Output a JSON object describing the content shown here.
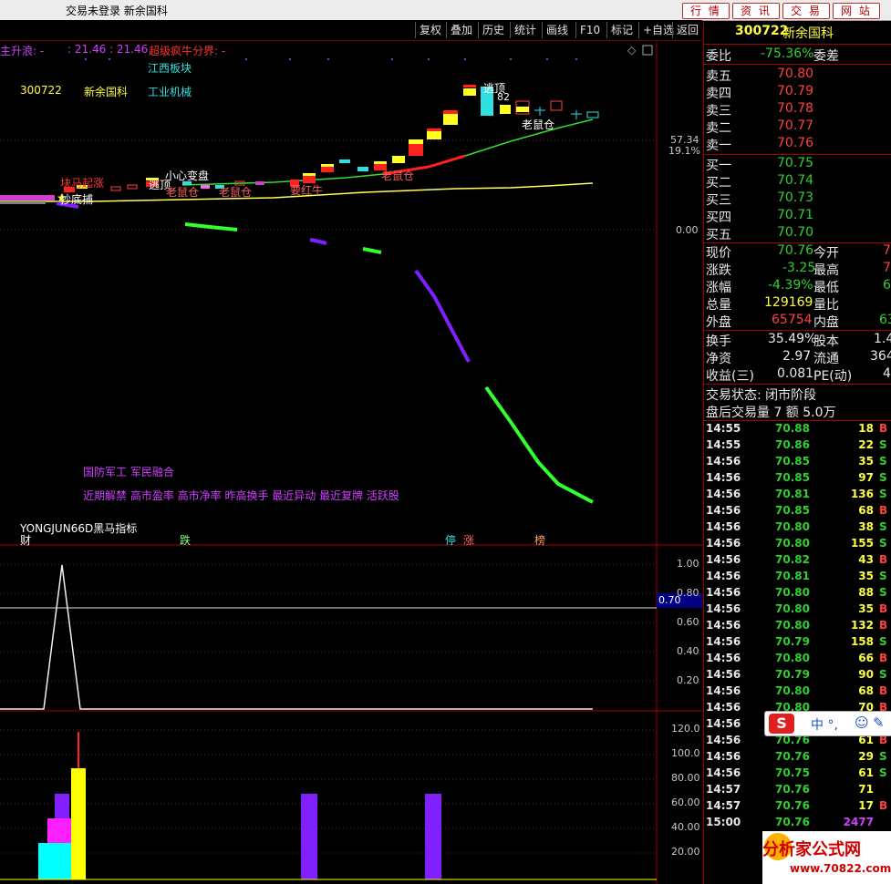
{
  "window": {
    "title": "交易未登录  新余国科",
    "nav_buttons": [
      "行 情",
      "资 讯",
      "交 易",
      "网 站"
    ]
  },
  "toolbar": [
    "复权",
    "叠加",
    "历史",
    "统计",
    "画线",
    "F10",
    "标记",
    "+自选",
    "返回"
  ],
  "chart": {
    "legend_prefix": "主升浪: -",
    "legend_values": ": 21.46 : 21.46",
    "legend_label": "超级疯牛分界: -",
    "sector": "江西板块",
    "code": "300722",
    "name": "新余国科",
    "industry": "工业机械",
    "concepts1": "国防军工 军民融合",
    "concepts2": "近期解禁 高市盈率 高市净率 昨高换手 最近异动 最近复牌 活跃股",
    "indicator": "YONGJUN66D黑马指标",
    "price_labels": [
      "57.34",
      "19.1%",
      "0.00"
    ],
    "annotations": {
      "taopao": "逃顶",
      "taopao2": "逃顶",
      "xiaoxin": "小心变盘",
      "laoshu1": "老鼠仓",
      "laoshu2": "老鼠仓",
      "laoshu3": "老鼠仓",
      "laoshu4": "老鼠仓",
      "liqizhang": "块马起涨",
      "chaodi": "抄底捕",
      "hongbao": "要红牛",
      "val": "82"
    },
    "bottom_marks": [
      "财",
      "跌",
      "停",
      "涨",
      "榜"
    ],
    "sub1_labels": [
      "1.00",
      "0.80",
      "0.60",
      "0.40",
      "0.20"
    ],
    "sub1_current": "0.70",
    "sub2_labels": [
      "120.0",
      "100.0",
      "80.00",
      "60.00",
      "40.00",
      "20.00"
    ]
  },
  "quote": {
    "code": "300722",
    "name": "新余国科",
    "weibi_label": "委比",
    "weibi": "-75.36%",
    "weicha_label": "委差",
    "sell": [
      {
        "label": "卖五",
        "price": "70.80"
      },
      {
        "label": "卖四",
        "price": "70.79"
      },
      {
        "label": "卖三",
        "price": "70.78"
      },
      {
        "label": "卖二",
        "price": "70.77"
      },
      {
        "label": "卖一",
        "price": "70.76"
      }
    ],
    "buy": [
      {
        "label": "买一",
        "price": "70.75"
      },
      {
        "label": "买二",
        "price": "70.74"
      },
      {
        "label": "买三",
        "price": "70.73"
      },
      {
        "label": "买四",
        "price": "70.71"
      },
      {
        "label": "买五",
        "price": "70.70"
      }
    ],
    "stats": [
      {
        "l1": "现价",
        "v1": "70.76",
        "l2": "今开",
        "v2": "7"
      },
      {
        "l1": "涨跌",
        "v1": "-3.25",
        "l2": "最高",
        "v2": "7"
      },
      {
        "l1": "涨幅",
        "v1": "-4.39%",
        "l2": "最低",
        "v2": "6"
      },
      {
        "l1": "总量",
        "v1": "129169",
        "l2": "量比",
        "v2": ""
      },
      {
        "l1": "外盘",
        "v1": "65754",
        "l2": "内盘",
        "v2": "63"
      }
    ],
    "stats2": [
      {
        "l1": "换手",
        "v1": "35.49%",
        "l2": "股本",
        "v2": "1.4"
      },
      {
        "l1": "净资",
        "v1": "2.97",
        "l2": "流通",
        "v2": "364"
      },
      {
        "l1": "收益(三)",
        "v1": "0.081",
        "l2": "PE(动)",
        "v2": "4"
      }
    ],
    "status": "交易状态: 闭市阶段",
    "after_hours": "盘后交易量 7 额 5.0万",
    "ticks": [
      {
        "t": "14:55",
        "p": "70.88",
        "v": "18",
        "s": "B"
      },
      {
        "t": "14:55",
        "p": "70.86",
        "v": "22",
        "s": "S"
      },
      {
        "t": "14:56",
        "p": "70.85",
        "v": "35",
        "s": "S"
      },
      {
        "t": "14:56",
        "p": "70.85",
        "v": "97",
        "s": "S"
      },
      {
        "t": "14:56",
        "p": "70.81",
        "v": "136",
        "s": "S"
      },
      {
        "t": "14:56",
        "p": "70.85",
        "v": "68",
        "s": "B"
      },
      {
        "t": "14:56",
        "p": "70.80",
        "v": "38",
        "s": "S"
      },
      {
        "t": "14:56",
        "p": "70.80",
        "v": "155",
        "s": "S"
      },
      {
        "t": "14:56",
        "p": "70.82",
        "v": "43",
        "s": "B"
      },
      {
        "t": "14:56",
        "p": "70.81",
        "v": "35",
        "s": "S"
      },
      {
        "t": "14:56",
        "p": "70.80",
        "v": "88",
        "s": "S"
      },
      {
        "t": "14:56",
        "p": "70.80",
        "v": "35",
        "s": "B"
      },
      {
        "t": "14:56",
        "p": "70.80",
        "v": "132",
        "s": "B"
      },
      {
        "t": "14:56",
        "p": "70.79",
        "v": "158",
        "s": "S"
      },
      {
        "t": "14:56",
        "p": "70.80",
        "v": "66",
        "s": "B"
      },
      {
        "t": "14:56",
        "p": "70.79",
        "v": "90",
        "s": "S"
      },
      {
        "t": "14:56",
        "p": "70.80",
        "v": "68",
        "s": "B"
      },
      {
        "t": "14:56",
        "p": "70.80",
        "v": "70",
        "s": "B"
      },
      {
        "t": "14:56",
        "p": "70.79",
        "v": "86",
        "s": "S"
      },
      {
        "t": "14:56",
        "p": "70.76",
        "v": "61",
        "s": "B"
      },
      {
        "t": "14:56",
        "p": "70.76",
        "v": "29",
        "s": "S"
      },
      {
        "t": "14:56",
        "p": "70.75",
        "v": "61",
        "s": "S"
      },
      {
        "t": "14:57",
        "p": "70.76",
        "v": "71",
        "s": ""
      },
      {
        "t": "14:57",
        "p": "70.76",
        "v": "17",
        "s": "B"
      },
      {
        "t": "15:00",
        "p": "70.76",
        "v": "2477",
        "s": ""
      }
    ]
  },
  "ime_bar": "中 °,",
  "watermark": {
    "text": "分析家公式网",
    "url": "www.70822.com"
  },
  "colors": {
    "up": "#ff4040",
    "down": "#30d030",
    "accent": "#ffff40",
    "border": "#a00000"
  }
}
